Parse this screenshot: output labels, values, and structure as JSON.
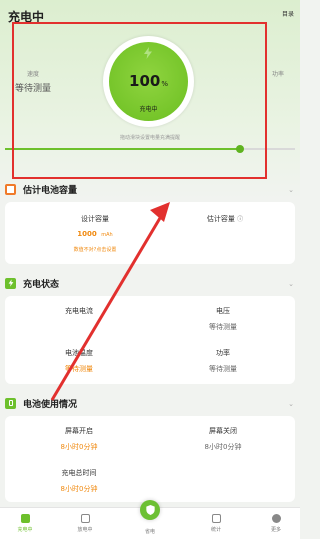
{
  "header": {
    "title": "充电中",
    "right_link": "目录"
  },
  "hero": {
    "left_label": "速度",
    "left_value": "等待测量",
    "right_label": "功率",
    "gauge_value": "100",
    "gauge_unit": "%",
    "gauge_status": "充电中",
    "slider_hint": "拖动滑块设置电量充满提醒",
    "slider_progress": 0.81
  },
  "sections": {
    "capacity": {
      "title": "估计电池容量",
      "design_label": "设计容量",
      "design_value": "1000",
      "design_unit": "mAh",
      "design_hint": "数值不对?点击设置",
      "estimate_label": "估计容量",
      "estimate_info": "ⓘ"
    },
    "charge_state": {
      "title": "充电状态",
      "current_label": "充电电流",
      "current_value": "",
      "voltage_label": "电压",
      "voltage_value": "等待测量",
      "temp_label": "电池温度",
      "temp_value": "等待测量",
      "power_label": "功率",
      "power_value": "等待测量"
    },
    "usage": {
      "title": "电池使用情况",
      "screen_on_label": "屏幕开启",
      "screen_on_value": "8小时0分钟",
      "screen_off_label": "屏幕关闭",
      "screen_off_value": "8小时0分钟",
      "total_label": "充电总时间",
      "total_value": "8小时0分钟"
    }
  },
  "nav": {
    "items": [
      {
        "label": "充电中",
        "icon": "charging-icon",
        "active": true
      },
      {
        "label": "放电中",
        "icon": "battery-icon",
        "active": false
      },
      {
        "label": "省电",
        "icon": "shield-icon",
        "active": false
      },
      {
        "label": "统计",
        "icon": "stats-icon",
        "active": false
      },
      {
        "label": "更多",
        "icon": "more-icon",
        "active": false
      }
    ]
  },
  "colors": {
    "accent": "#6dc02c",
    "orange": "#f0890f",
    "annotation": "#e2302e"
  }
}
